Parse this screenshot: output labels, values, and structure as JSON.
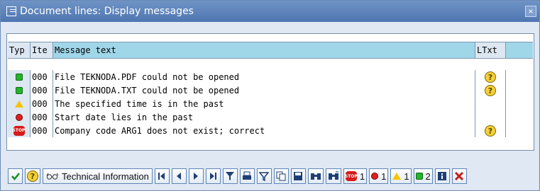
{
  "window": {
    "title": "Document lines: Display messages",
    "close_glyph": "×"
  },
  "table": {
    "headers": {
      "typ": "Typ",
      "item": "Ite",
      "message": "Message text",
      "ltxt": "LTxt"
    },
    "rows": [
      {
        "type_icon": "green-square-icon",
        "item": "000",
        "message": "File TEKNODA.PDF could not be opened",
        "ltxt_icon": "help-icon"
      },
      {
        "type_icon": "green-square-icon",
        "item": "000",
        "message": "File TEKNODA.TXT could not be opened",
        "ltxt_icon": "help-icon"
      },
      {
        "type_icon": "warning-triangle-icon",
        "item": "000",
        "message": "The specified time is in the past",
        "ltxt_icon": ""
      },
      {
        "type_icon": "error-bug-icon",
        "item": "000",
        "message": "Start date lies in the past",
        "ltxt_icon": ""
      },
      {
        "type_icon": "stop-sign-icon",
        "item": "000",
        "message": "Company code ARG1 does not exist; correct",
        "ltxt_icon": "help-icon"
      }
    ]
  },
  "toolbar": {
    "technical_info_label": "Technical Information",
    "stop_count": "1",
    "error_count": "1",
    "warning_count": "1",
    "info_count": "2",
    "stop_label": "STOP",
    "help_glyph": "?"
  }
}
